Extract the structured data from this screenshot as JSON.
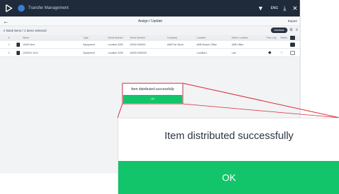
{
  "topbar": {
    "app_title": "Transfer Management",
    "language": "ENG"
  },
  "header": {
    "title": "Assign / Update",
    "action": "Export"
  },
  "info": {
    "selection_count": "2 listed items / 1 items selected",
    "distribute_label": "Distribute"
  },
  "table": {
    "columns": [
      "#",
      "Name",
      "Type",
      "Serial Number",
      "Serial Number",
      "Company",
      "Location",
      "Maint. Location",
      "Time Log",
      "Status"
    ],
    "rows": [
      {
        "num": "1",
        "name": "10000 Item",
        "type": "Equipment",
        "serial": "Location 0290",
        "company": "00000 000000",
        "company2": "ABB Fire Stove",
        "location": "ABB Keeper Office",
        "maint": "ABB Office"
      },
      {
        "num": "2",
        "name": "1000014 1401",
        "type": "Equipment",
        "serial": "Location 0290",
        "company": "00000 0000000",
        "company2": "",
        "location": "Location1",
        "maint": "Lab"
      }
    ]
  },
  "dialog": {
    "message": "Item distributed successfully",
    "ok_label": "OK"
  },
  "colors": {
    "topbar": "#1f2a3a",
    "accent_green": "#12c46a",
    "callout_line": "#d9262e",
    "dark_button": "#283242"
  },
  "icons": [
    "app-logo-icon",
    "app-icon",
    "filter-icon",
    "download-icon",
    "close-icon",
    "back-arrow-icon",
    "settings-icon",
    "menu-icon",
    "item-icon",
    "tag-icon",
    "chat-icon"
  ]
}
